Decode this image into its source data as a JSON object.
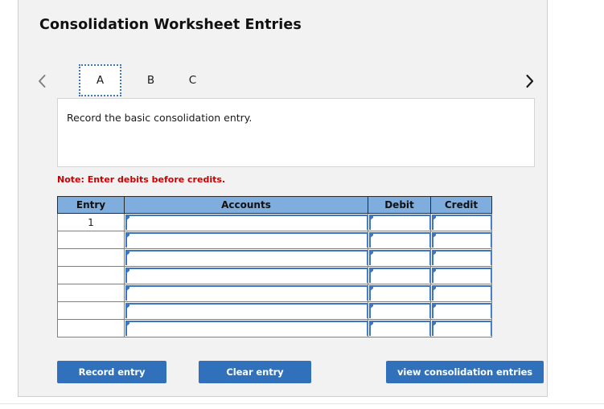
{
  "card": {
    "title": "Consolidation Worksheet Entries"
  },
  "tabs": {
    "prev_icon": "chevron-left-icon",
    "next_icon": "chevron-right-icon",
    "items": [
      {
        "label": "A",
        "selected": true
      },
      {
        "label": "B",
        "selected": false
      },
      {
        "label": "C",
        "selected": false
      }
    ]
  },
  "instruction": {
    "text": "Record the basic consolidation entry."
  },
  "note": {
    "text": "Note: Enter debits before credits.",
    "color": "#cc0000"
  },
  "table": {
    "headers": [
      "Entry",
      "Accounts",
      "Debit",
      "Credit"
    ],
    "rows": [
      {
        "entry": "1",
        "accounts": "",
        "debit": "",
        "credit": ""
      },
      {
        "entry": "",
        "accounts": "",
        "debit": "",
        "credit": ""
      },
      {
        "entry": "",
        "accounts": "",
        "debit": "",
        "credit": ""
      },
      {
        "entry": "",
        "accounts": "",
        "debit": "",
        "credit": ""
      },
      {
        "entry": "",
        "accounts": "",
        "debit": "",
        "credit": ""
      },
      {
        "entry": "",
        "accounts": "",
        "debit": "",
        "credit": ""
      },
      {
        "entry": "",
        "accounts": "",
        "debit": "",
        "credit": ""
      }
    ],
    "header_color": "#7fadde",
    "input_border_color": "#3b76c4"
  },
  "buttons": {
    "record": "Record entry",
    "clear": "Clear entry",
    "view": "view consolidation entries",
    "color": "#3170bb"
  }
}
